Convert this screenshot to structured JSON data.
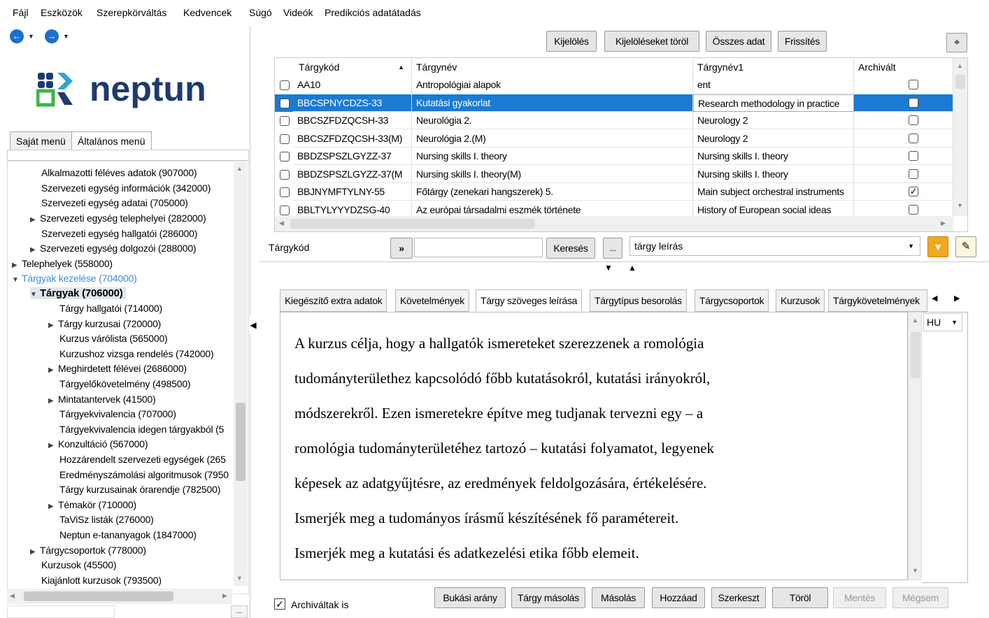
{
  "menubar": {
    "items": [
      "Fájl",
      "Eszközök",
      "Szerepkörváltás",
      "Kedvencek",
      "Súgó",
      "Videók",
      "Predikciós adatátadás"
    ]
  },
  "logo": {
    "text": "neptun"
  },
  "menu_tabs": [
    "Saját menü",
    "Általános menü"
  ],
  "tree": [
    {
      "label": "Alkalmazotti féléves adatok (907000)"
    },
    {
      "label": "Szervezeti egység információk (342000)"
    },
    {
      "label": "Szervezeti egység adatai (705000)"
    },
    {
      "label": "Szervezeti egység telephelyei (282000)"
    },
    {
      "label": "Szervezeti egység hallgatói (286000)"
    },
    {
      "label": "Szervezeti egység dolgozói (288000)"
    },
    {
      "label": "Telephelyek (558000)"
    },
    {
      "label": "Tárgyak kezelése (704000)"
    },
    {
      "label": "Tárgyak (706000)"
    },
    {
      "label": "Tárgy hallgatói (714000)"
    },
    {
      "label": "Tárgy kurzusai (720000)"
    },
    {
      "label": "Kurzus várólista (565000)"
    },
    {
      "label": "Kurzushoz vizsga rendelés (742000)"
    },
    {
      "label": "Meghirdetett félévei (2686000)"
    },
    {
      "label": "Tárgyelőkövetelmény (498500)"
    },
    {
      "label": "Mintatantervek (41500)"
    },
    {
      "label": "Tárgyekvivalencia (707000)"
    },
    {
      "label": "Tárgyekvivalencia idegen tárgyakból (5"
    },
    {
      "label": "Konzultáció (567000)"
    },
    {
      "label": "Hozzárendelt szervezeti egységek (265"
    },
    {
      "label": "Eredményszámolási algoritmusok (7950"
    },
    {
      "label": "Tárgy kurzusainak órarendje (782500)"
    },
    {
      "label": "Témakör (710000)"
    },
    {
      "label": "TaViSz listák (276000)"
    },
    {
      "label": "Neptun e-tananyagok (1847000)"
    },
    {
      "label": "Tárgycsoportok (778000)"
    },
    {
      "label": "Kurzusok (45500)"
    },
    {
      "label": "Kiajánlott kurzusok (793500)"
    }
  ],
  "toolbar": {
    "kijeloles": "Kijelölés",
    "kijelolesek_torol": "Kijelöléseket töröl",
    "osszes_adat": "Összes adat",
    "frissites": "Frissítés"
  },
  "grid": {
    "columns": [
      "Tárgykód",
      "Tárgynév",
      "Tárgynév1",
      "Archivált"
    ],
    "rows": [
      {
        "kod": "AA10",
        "nev": "Antropológiai alapok",
        "nev1": "ent",
        "arch": ""
      },
      {
        "kod": "BBCSPNYCDZS-33",
        "nev": "Kutatási gyakorlat",
        "nev1": "Research methodology in practice",
        "arch": ""
      },
      {
        "kod": "BBCSZFDZQCSH-33",
        "nev": "Neurológia 2.",
        "nev1": "Neurology 2",
        "arch": ""
      },
      {
        "kod": "BBCSZFDZQCSH-33(M)",
        "nev": "Neurológia 2.(M)",
        "nev1": "Neurology 2",
        "arch": ""
      },
      {
        "kod": "BBDZSPSZLGYZZ-37",
        "nev": "Nursing skills I. theory",
        "nev1": "Nursing skills I. theory",
        "arch": ""
      },
      {
        "kod": "BBDZSPSZLGYZZ-37(M",
        "nev": "Nursing skills I. theory(M)",
        "nev1": "Nursing skills I. theory",
        "arch": ""
      },
      {
        "kod": "BBJNYMFTYLNY-55",
        "nev": "Főtárgy (zenekari hangszerek) 5.",
        "nev1": "Main subject orchestral instruments",
        "arch": "✓"
      },
      {
        "kod": "BBLTYLYYYDZSG-40",
        "nev": "Az európai társadalmi eszmék története",
        "nev1": "History of European social ideas",
        "arch": ""
      }
    ]
  },
  "search": {
    "label": "Tárgykód",
    "arrows": "»",
    "button": "Keresés",
    "dots": "...",
    "dropdown_value": "tárgy leírás"
  },
  "tabs": [
    "Kiegészítő extra adatok",
    "Követelmények",
    "Tárgy szöveges leírása",
    "Tárgytípus besorolás",
    "Tárgycsoportok",
    "Kurzusok",
    "Tárgykövetelmények"
  ],
  "lang": "HU",
  "description": [
    "A kurzus célja, hogy a hallgatók ismereteket szerezzenek a romológia",
    "tudományterülethez kapcsolódó főbb kutatásokról, kutatási irányokról,",
    "módszerekről. Ezen ismeretekre építve meg tudjanak tervezni egy – a",
    "romológia tudományterületéhez tartozó – kutatási folyamatot, legyenek",
    "képesek az adatgyűjtésre, az eredmények feldolgozására, értékelésére.",
    "Ismerjék meg a tudományos írásmű készítésének fő paramétereit.",
    "Ismerjék meg a kutatási és adatkezelési etika főbb elemeit."
  ],
  "bottom": {
    "archivaltak": "Archiváltak is",
    "bukasi_arany": "Bukási arány",
    "targy_masolas": "Tárgy másolás",
    "masolas": "Másolás",
    "hozzaad": "Hozzáad",
    "szerkeszt": "Szerkeszt",
    "torol": "Töröl",
    "mentes": "Mentés",
    "megsem": "Mégsem"
  },
  "colors": {
    "selection": "#1a7ad4",
    "link": "#3a8dde",
    "logo": "#1e3a6e",
    "filter": "#f2a81d"
  }
}
